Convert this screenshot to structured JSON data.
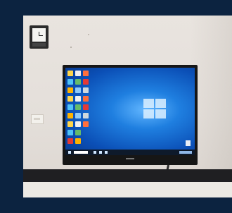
{
  "scene": {
    "description_label": "",
    "colors": {
      "outer_border": "#0c2340",
      "wall": "#e6e1dc",
      "baseboard": "#1f1f22",
      "monitor_bezel": "#161616",
      "desktop_blue": "#1f7fe0",
      "taskbar": "#0e1a2b"
    },
    "objects": {
      "wall_clock": "clock-icon",
      "light_switch": "switch-icon",
      "display": "monitor",
      "os_logo": "windows-logo-icon"
    }
  }
}
